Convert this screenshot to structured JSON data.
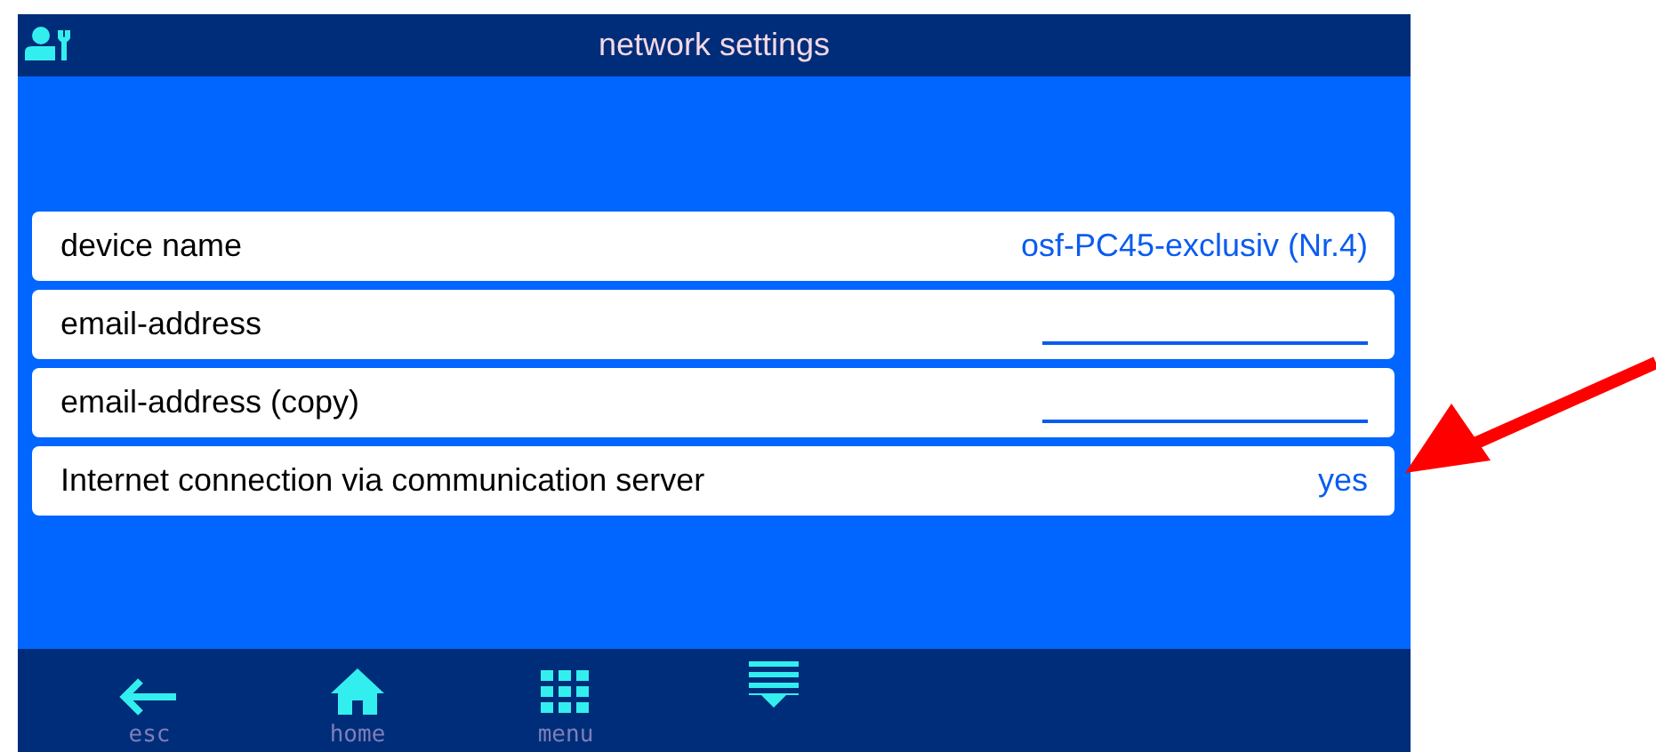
{
  "header": {
    "title": "network settings"
  },
  "rows": [
    {
      "label": "device name",
      "kind": "text",
      "value": "osf-PC45-exclusiv (Nr.4)"
    },
    {
      "label": "email-address",
      "kind": "blank"
    },
    {
      "label": "email-address (copy)",
      "kind": "blank"
    },
    {
      "label": "Internet connection via communication server",
      "kind": "text",
      "value": "yes"
    }
  ],
  "footer": [
    {
      "kind": "back",
      "label": "esc"
    },
    {
      "kind": "home",
      "label": "home"
    },
    {
      "kind": "grid",
      "label": "menu"
    },
    {
      "kind": "list"
    }
  ]
}
